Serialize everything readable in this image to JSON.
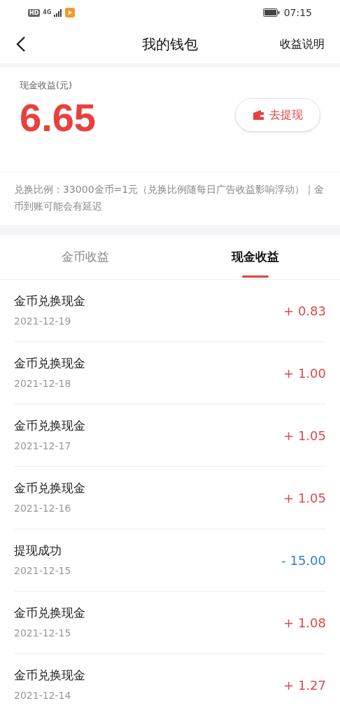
{
  "status_bar": {
    "hd": "HD",
    "network": "4G",
    "time": "07:15"
  },
  "header": {
    "title": "我的钱包",
    "action": "收益说明"
  },
  "summary": {
    "label": "现金收益(元)",
    "amount": "6.65",
    "button": "去提现"
  },
  "notice": "兑换比例：33000金币=1元（兑换比例随每日广告收益影响浮动）｜金币到账可能会有延迟",
  "tabs": [
    {
      "label": "金币收益",
      "selected": false
    },
    {
      "label": "现金收益",
      "selected": true
    }
  ],
  "transactions": [
    {
      "title": "金币兑换现金",
      "date": "2021-12-19",
      "amount": "+ 0.83",
      "kind": "income"
    },
    {
      "title": "金币兑换现金",
      "date": "2021-12-18",
      "amount": "+ 1.00",
      "kind": "income"
    },
    {
      "title": "金币兑换现金",
      "date": "2021-12-17",
      "amount": "+ 1.05",
      "kind": "income"
    },
    {
      "title": "金币兑换现金",
      "date": "2021-12-16",
      "amount": "+ 1.05",
      "kind": "income"
    },
    {
      "title": "提现成功",
      "date": "2021-12-15",
      "amount": "- 15.00",
      "kind": "withdrawal"
    },
    {
      "title": "金币兑换现金",
      "date": "2021-12-15",
      "amount": "+ 1.08",
      "kind": "income"
    },
    {
      "title": "金币兑换现金",
      "date": "2021-12-14",
      "amount": "+ 1.27",
      "kind": "income"
    }
  ]
}
